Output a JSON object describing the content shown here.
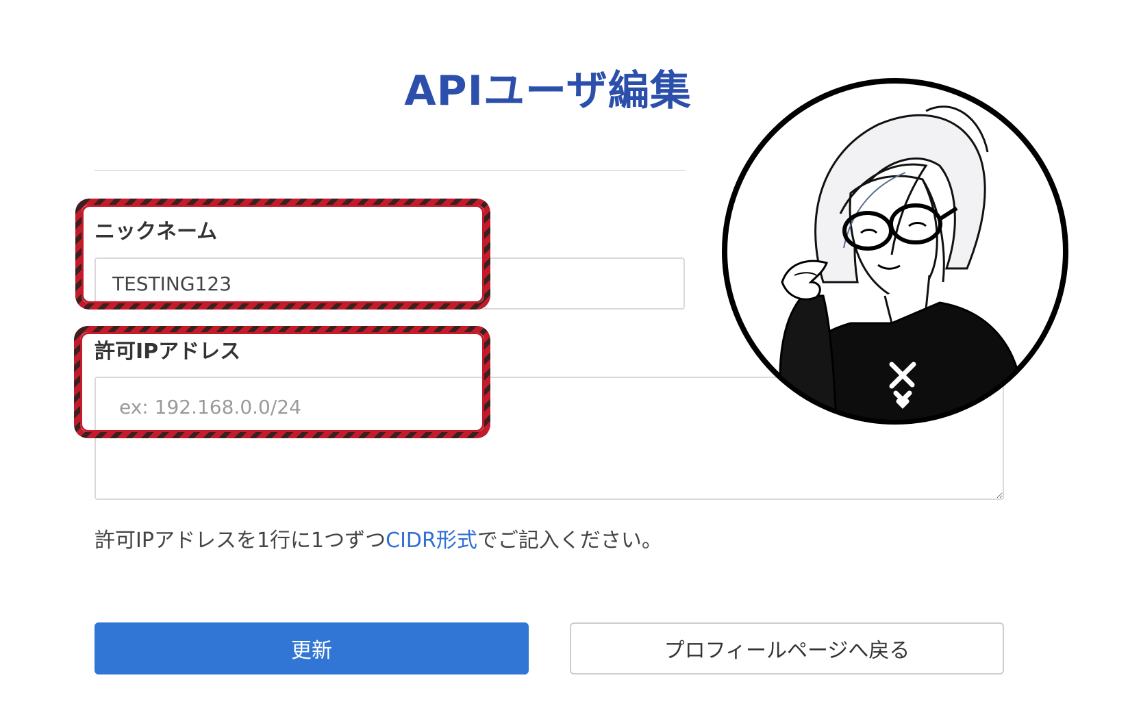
{
  "page": {
    "title": "APIユーザ編集"
  },
  "form": {
    "nickname": {
      "label": "ニックネーム",
      "value": "TESTING123"
    },
    "allowed_ip": {
      "label": "許可IPアドレス",
      "placeholder": "ex: 192.168.0.0/24",
      "value": ""
    },
    "help": {
      "prefix": "許可IPアドレスを1行に1つずつ",
      "link": "CIDR形式",
      "suffix": "でご記入ください。"
    },
    "submit_label": "更新",
    "back_label": "プロフィールページへ戻る"
  },
  "colors": {
    "title": "#2b4faa",
    "primary_button": "#3176d4",
    "link": "#2f6fd6",
    "highlight_border": "#c41b2a"
  }
}
